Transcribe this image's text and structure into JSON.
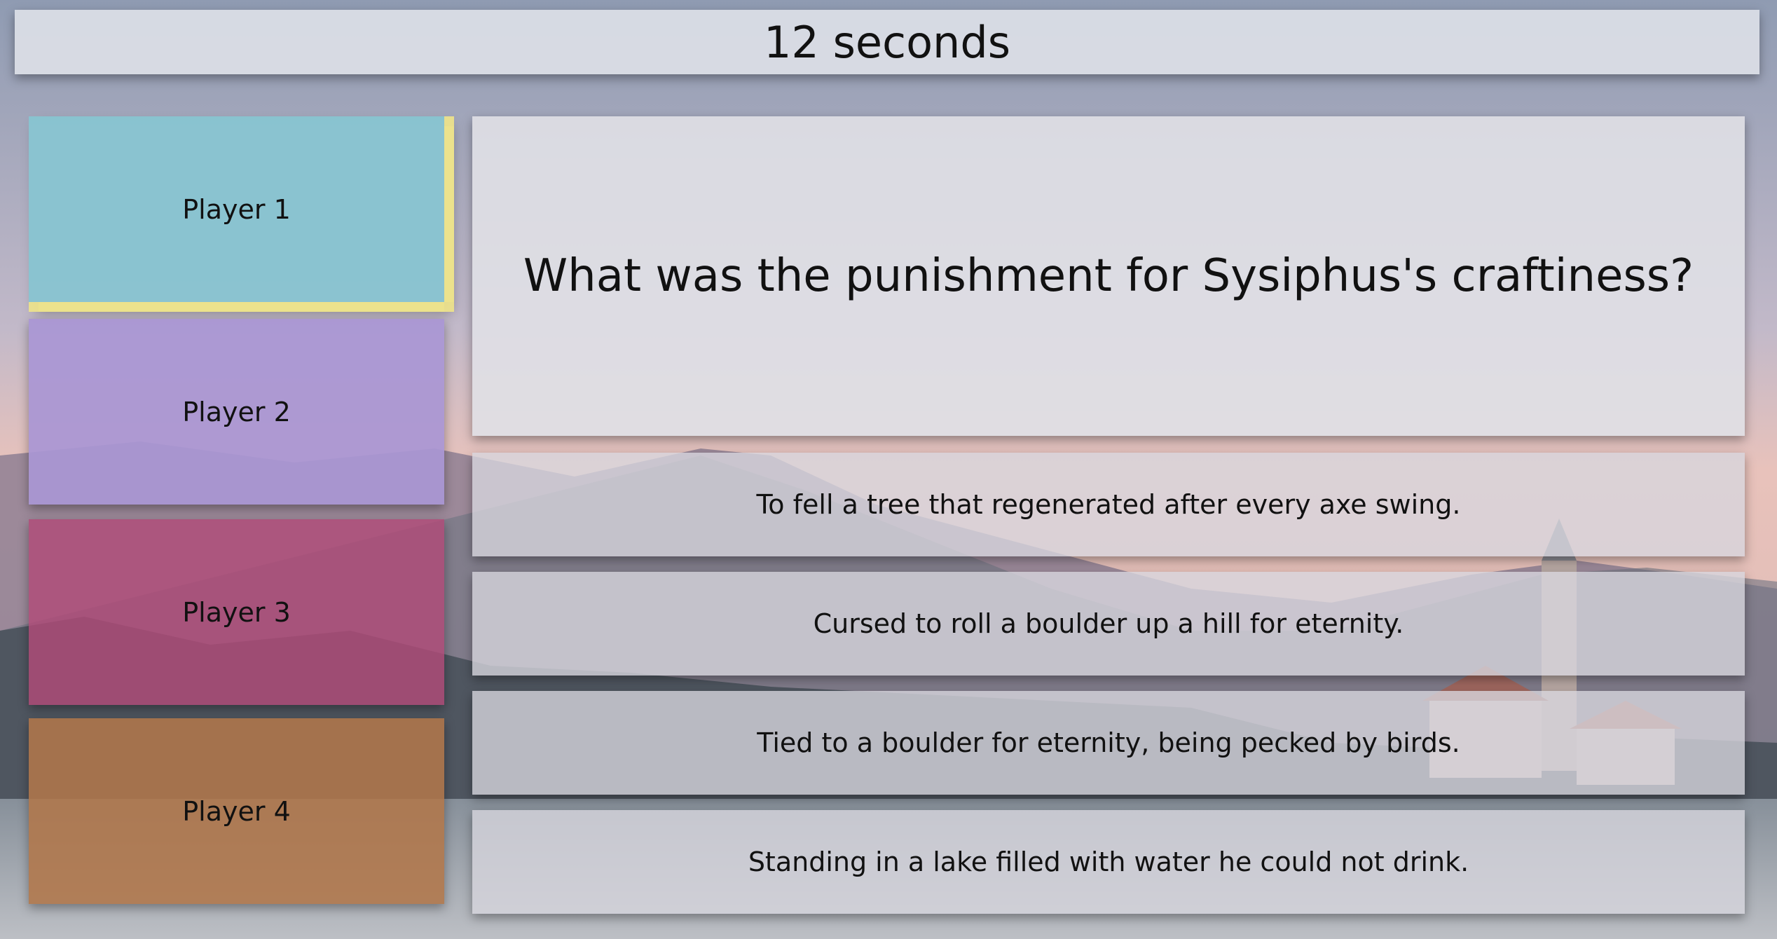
{
  "timer": {
    "label": "12 seconds"
  },
  "players": [
    {
      "label": "Player 1",
      "color": "#88c4d0",
      "active": true
    },
    {
      "label": "Player 2",
      "color": "#a996d4",
      "active": false
    },
    {
      "label": "Player 3",
      "color": "#b04a78",
      "active": false
    },
    {
      "label": "Player 4",
      "color": "#b0764a",
      "active": false
    }
  ],
  "question": {
    "text": "What was the punishment for Sysiphus's craftiness?"
  },
  "answers": [
    {
      "text": "To fell a tree that regenerated after every axe swing."
    },
    {
      "text": "Cursed to roll a boulder up a hill for eternity."
    },
    {
      "text": "Tied to a boulder for eternity, being pecked by birds."
    },
    {
      "text": "Standing in a lake filled with water he could not drink."
    }
  ],
  "colors": {
    "highlight": "#ece18c"
  }
}
